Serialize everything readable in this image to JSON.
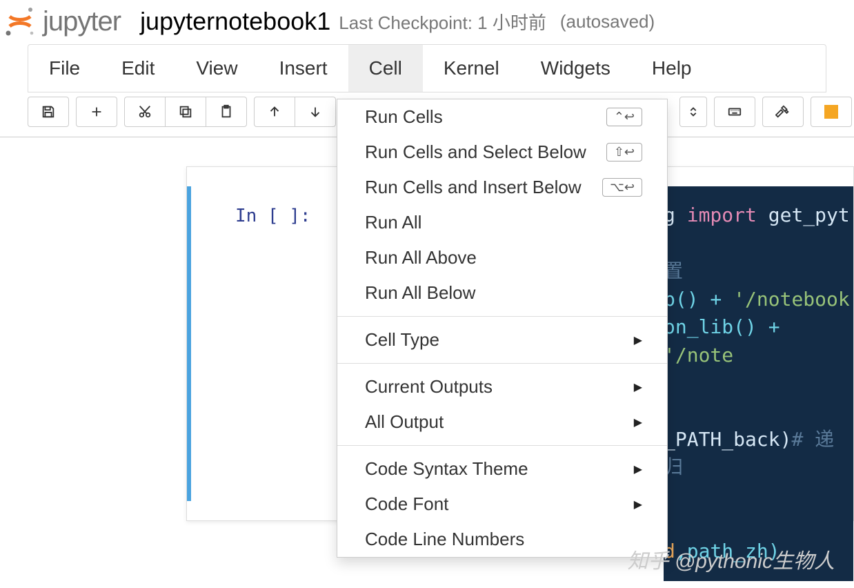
{
  "header": {
    "logo_word": "jupyter",
    "notebook_name": "jupyternotebook1",
    "checkpoint": "Last Checkpoint: 1 小时前",
    "autosaved": "(autosaved)"
  },
  "menubar": [
    "File",
    "Edit",
    "View",
    "Insert",
    "Cell",
    "Kernel",
    "Widgets",
    "Help"
  ],
  "menubar_active_index": 4,
  "toolbar": {
    "save": "save-icon",
    "add": "add-icon",
    "cut": "cut-icon",
    "copy": "copy-icon",
    "paste": "paste-icon",
    "up": "up-icon",
    "down": "down-icon",
    "updown": "updown-icon",
    "keyboard": "keyboard-icon",
    "gavel": "gavel-icon",
    "square": "square-icon"
  },
  "dropdown": {
    "sections": [
      [
        {
          "label": "Run Cells",
          "shortcut": "⌃↩"
        },
        {
          "label": "Run Cells and Select Below",
          "shortcut": "⇧↩"
        },
        {
          "label": "Run Cells and Insert Below",
          "shortcut": "⌥↩"
        },
        {
          "label": "Run All"
        },
        {
          "label": "Run All Above"
        },
        {
          "label": "Run All Below"
        }
      ],
      [
        {
          "label": "Cell Type",
          "submenu": true
        }
      ],
      [
        {
          "label": "Current Outputs",
          "submenu": true
        },
        {
          "label": "All Output",
          "submenu": true
        }
      ],
      [
        {
          "label": "Code Syntax Theme",
          "submenu": true
        },
        {
          "label": "Code Font",
          "submenu": true
        },
        {
          "label": "Code Line Numbers"
        }
      ]
    ]
  },
  "cell": {
    "prompt": "In [ ]:",
    "code_visible_fragments": {
      "l1_g": "g ",
      "l1_import": "import",
      "l1_tail": " get_pyt",
      "l2": "置",
      "l3_a": "b() + ",
      "l3_s": "'/notebook",
      "l4_a": "on_lib() + ",
      "l4_s": "'/note",
      "l5_a": "_PATH_back)",
      "l5_c": "#  递归",
      "l6_a": "d",
      "l6_b": ",path_zh)"
    }
  },
  "watermark": "知乎 @pythonic生物人"
}
